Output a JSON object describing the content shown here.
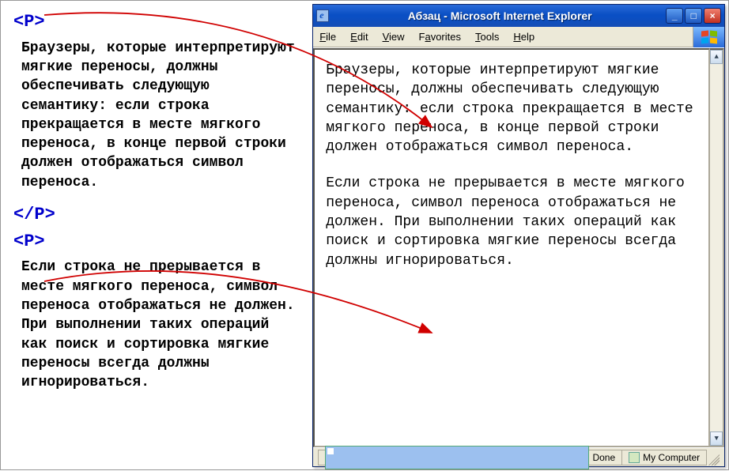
{
  "code": {
    "open_tag": "<P>",
    "close_tag": "</P>",
    "open_tag2": "<P>",
    "para1": "Браузеры, которые интерпретируют мягкие переносы, должны обеспечивать следующую семантику: если строка прекращается в месте мягкого переноса, в конце первой строки должен отображаться символ переноса.",
    "para2": "Если строка не прерывается в месте мягкого переноса, символ переноса отображаться не должен. При выполнении таких операций как поиск и сортировка мягкие переносы всегда должны игнорироваться."
  },
  "browser": {
    "title": "Абзац - Microsoft Internet Explorer",
    "menus": {
      "file": "File",
      "edit": "Edit",
      "view": "View",
      "favorites": "Favorites",
      "tools": "Tools",
      "help": "Help"
    },
    "page": {
      "para1": "Браузеры, которые интерпретируют мягкие переносы, должны обеспечивать следующую семантику: если строка прекращается в месте мягкого переноса, в конце первой строки должен отображаться символ переноса.",
      "para2": "Если строка не прерывается в месте мягкого переноса, символ переноса отображаться не должен. При выполнении таких операций как поиск и сортировка мягкие переносы всегда должны игнорироваться."
    },
    "status": {
      "done": "Done",
      "zone": "My Computer"
    }
  }
}
